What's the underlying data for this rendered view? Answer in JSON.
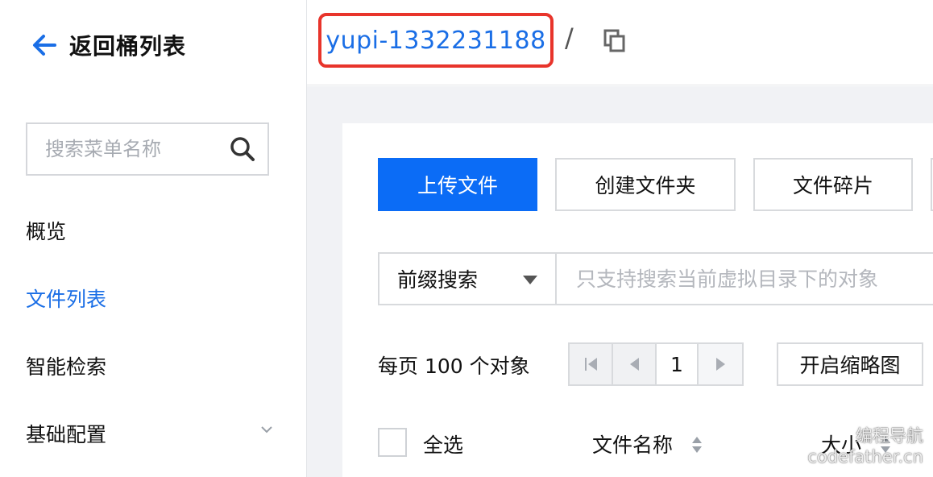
{
  "sidebar": {
    "back_label": "返回桶列表",
    "search_placeholder": "搜索菜单名称",
    "items": [
      {
        "label": "概览"
      },
      {
        "label": "文件列表"
      },
      {
        "label": "智能检索"
      },
      {
        "label": "基础配置"
      }
    ]
  },
  "header": {
    "bucket_name": "yupi-1332231188",
    "separator": "/"
  },
  "toolbar": {
    "upload_label": "上传文件",
    "new_folder_label": "创建文件夹",
    "fragments_label": "文件碎片"
  },
  "search_bar": {
    "mode_selected": "前缀搜索",
    "placeholder": "只支持搜索当前虚拟目录下的对象"
  },
  "pagination": {
    "per_page_text": "每页 100 个对象",
    "current_page": "1"
  },
  "thumbnail_button_label": "开启缩略图",
  "table": {
    "select_all_label": "全选",
    "columns": [
      "文件名称",
      "大小"
    ]
  },
  "watermark": {
    "line1": "编程导航",
    "line2": "codefather.cn"
  },
  "colors": {
    "accent": "#0b6cf6",
    "link": "#1a6ee6",
    "highlight_border": "#e8342b"
  }
}
